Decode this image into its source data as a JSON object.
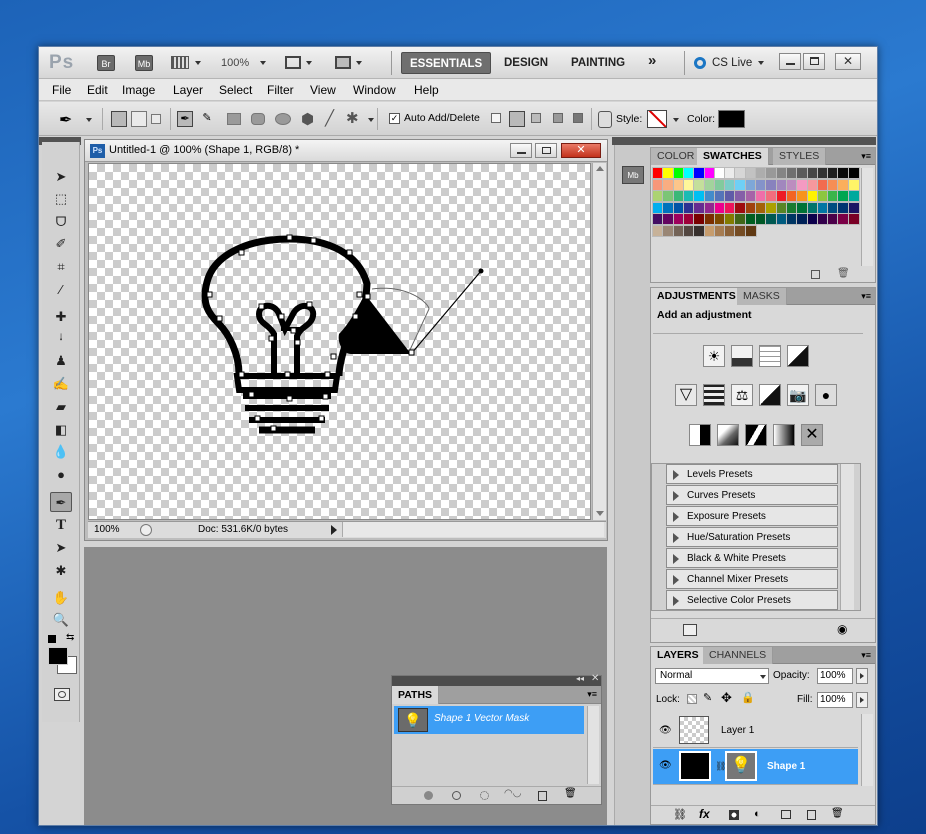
{
  "appbar": {
    "logo": "Ps",
    "br": "Br",
    "mb": "Mb",
    "zoom": "100%",
    "workspaces": [
      "ESSENTIALS",
      "DESIGN",
      "PAINTING"
    ],
    "more": "»",
    "cslive": "CS Live"
  },
  "menu": [
    "File",
    "Edit",
    "Image",
    "Layer",
    "Select",
    "Filter",
    "View",
    "Window",
    "Help"
  ],
  "options": {
    "auto_add_delete": "Auto Add/Delete",
    "style_label": "Style:",
    "color_label": "Color:",
    "color": "#000000"
  },
  "document": {
    "title": "Untitled-1 @ 100% (Shape 1, RGB/8) *",
    "ps_icon": "Ps",
    "zoom": "100%",
    "doc_info": "Doc: 531.6K/0 bytes"
  },
  "swatches": {
    "tabs": [
      "COLOR",
      "SWATCHES",
      "STYLES"
    ],
    "active": "SWATCHES",
    "colors": [
      "#ff0000",
      "#ffff00",
      "#00ff00",
      "#00ffff",
      "#0000ff",
      "#ff00ff",
      "#ffffff",
      "#ebebeb",
      "#d6d6d6",
      "#c2c2c2",
      "#adadad",
      "#999999",
      "#858585",
      "#707070",
      "#5c5c5c",
      "#474747",
      "#333333",
      "#1f1f1f",
      "#0a0a0a",
      "#000000",
      "#f7977a",
      "#f9ad81",
      "#fdc68a",
      "#fff79a",
      "#c4df9b",
      "#a2d39c",
      "#82ca9d",
      "#7bcdc8",
      "#6ecff6",
      "#7ea7d8",
      "#8493ca",
      "#8882be",
      "#a187be",
      "#bc8dbf",
      "#f49ac2",
      "#f6989d",
      "#f26c4f",
      "#f68e55",
      "#fbaf5c",
      "#fff467",
      "#acd372",
      "#7cc576",
      "#3bb878",
      "#1abbb4",
      "#00bff3",
      "#438ccb",
      "#5574b9",
      "#605ca8",
      "#855fa8",
      "#a763a8",
      "#f06ea9",
      "#f26d7d",
      "#ed1c24",
      "#f26522",
      "#f7941d",
      "#fff200",
      "#8dc63f",
      "#39b54a",
      "#00a651",
      "#00a99d",
      "#00aeef",
      "#0072bc",
      "#0054a6",
      "#2e3192",
      "#662d91",
      "#92278f",
      "#ec008c",
      "#ed145b",
      "#9e0b0f",
      "#a0410d",
      "#a36209",
      "#aba000",
      "#598527",
      "#1a7b30",
      "#007236",
      "#00746b",
      "#0076a3",
      "#004b80",
      "#003471",
      "#1b1464",
      "#440e62",
      "#630460",
      "#9e005d",
      "#9e0039",
      "#790000",
      "#7b2e00",
      "#7d4900",
      "#827b00",
      "#406618",
      "#005e20",
      "#005826",
      "#005952",
      "#005b7f",
      "#003663",
      "#002157",
      "#0d004c",
      "#32004b",
      "#4b0049",
      "#7b0046",
      "#7a0026",
      "#c7b299",
      "#998675",
      "#736357",
      "#534741",
      "#37302d",
      "#c69c6d",
      "#a67c52",
      "#8c6239",
      "#754c24",
      "#603913"
    ]
  },
  "adjustments": {
    "tabs": [
      "ADJUSTMENTS",
      "MASKS"
    ],
    "title": "Add an adjustment",
    "presets": [
      "Levels Presets",
      "Curves Presets",
      "Exposure Presets",
      "Hue/Saturation Presets",
      "Black & White Presets",
      "Channel Mixer Presets",
      "Selective Color Presets"
    ]
  },
  "layers": {
    "tabs": [
      "LAYERS",
      "CHANNELS"
    ],
    "blend": "Normal",
    "opacity_label": "Opacity:",
    "opacity": "100%",
    "lock_label": "Lock:",
    "fill_label": "Fill:",
    "fill": "100%",
    "items": [
      {
        "name": "Layer 1"
      },
      {
        "name": "Shape 1"
      }
    ]
  },
  "paths": {
    "tab": "PATHS",
    "items": [
      "Shape 1 Vector Mask"
    ]
  }
}
